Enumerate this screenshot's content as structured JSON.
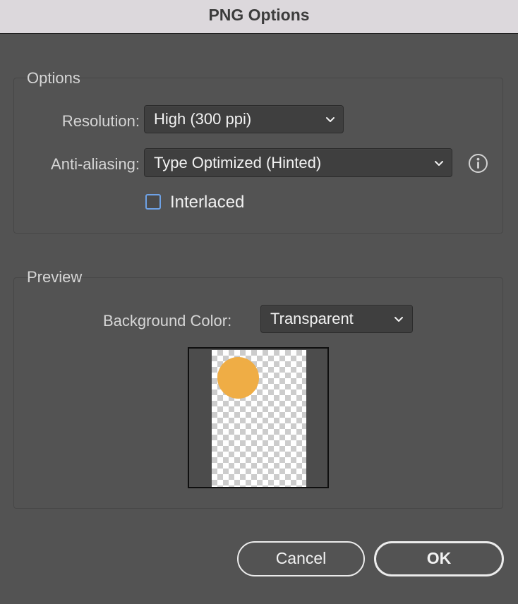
{
  "window": {
    "title": "PNG Options"
  },
  "options": {
    "group_title": "Options",
    "resolution": {
      "label": "Resolution:",
      "value": "High (300 ppi)"
    },
    "anti_aliasing": {
      "label": "Anti-aliasing:",
      "value": "Type Optimized (Hinted)",
      "info_icon": "info-circle-icon"
    },
    "interlaced": {
      "label": "Interlaced",
      "checked": false
    }
  },
  "preview": {
    "group_title": "Preview",
    "background_color": {
      "label": "Background Color:",
      "value": "Transparent"
    },
    "thumbnail": {
      "background": "transparent-checkerboard",
      "shape": "circle",
      "shape_color": "#efad45"
    }
  },
  "buttons": {
    "cancel_label": "Cancel",
    "ok_label": "OK"
  },
  "colors": {
    "dialog_background": "#535353",
    "titlebar_background": "#dcd8dc",
    "checkbox_accent": "#6ea2e6"
  }
}
